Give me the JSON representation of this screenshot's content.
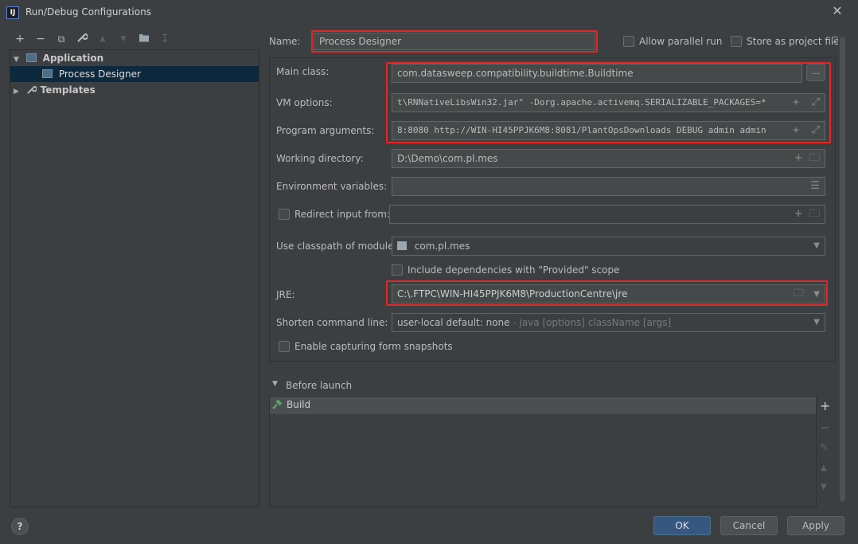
{
  "window": {
    "title": "Run/Debug Configurations",
    "app_icon_text": "IJ"
  },
  "toolbar": {
    "add": "+",
    "remove": "−",
    "copy": "⧉",
    "edit": "🔧",
    "up": "▲",
    "down": "▼",
    "folder": "📁",
    "sort": "↧"
  },
  "tree": {
    "application_label": "Application",
    "process_designer_label": "Process Designer",
    "templates_label": "Templates"
  },
  "form": {
    "name_label": "Name:",
    "name_value": "Process Designer",
    "allow_parallel_label": "Allow parallel run",
    "store_project_label": "Store as project file",
    "main_class_label": "Main class:",
    "main_class_value": "com.datasweep.compatibility.buildtime.Buildtime",
    "vm_options_label": "VM options:",
    "vm_options_value": "t\\RNNativeLibsWin32.jar\" -Dorg.apache.activemq.SERIALIZABLE_PACKAGES=*",
    "program_args_label": "Program arguments:",
    "program_args_value": "8:8080 http://WIN-HI45PPJK6M8:8081/PlantOpsDownloads DEBUG admin admin",
    "working_dir_label": "Working directory:",
    "working_dir_value": "D:\\Demo\\com.pl.mes",
    "env_vars_label": "Environment variables:",
    "redirect_label": "Redirect input from:",
    "classpath_label": "Use classpath of module:",
    "classpath_value": "com.pl.mes",
    "include_deps_label": "Include dependencies with \"Provided\" scope",
    "jre_label": "JRE:",
    "jre_value": "C:\\.FTPC\\WIN-HI45PPJK6M8\\ProductionCentre\\jre",
    "shorten_label": "Shorten command line:",
    "shorten_value": "user-local default: none",
    "shorten_hint": " - java [options] className [args]",
    "snapshots_label": "Enable capturing form snapshots",
    "ellipsis": "..."
  },
  "before_launch": {
    "header": "Before launch",
    "items": [
      {
        "label": "Build"
      }
    ]
  },
  "footer": {
    "help": "?",
    "ok": "OK",
    "cancel": "Cancel",
    "apply": "Apply"
  },
  "colors": {
    "accent": "#365880",
    "highlight": "#e52626",
    "selection": "#0d293e"
  }
}
